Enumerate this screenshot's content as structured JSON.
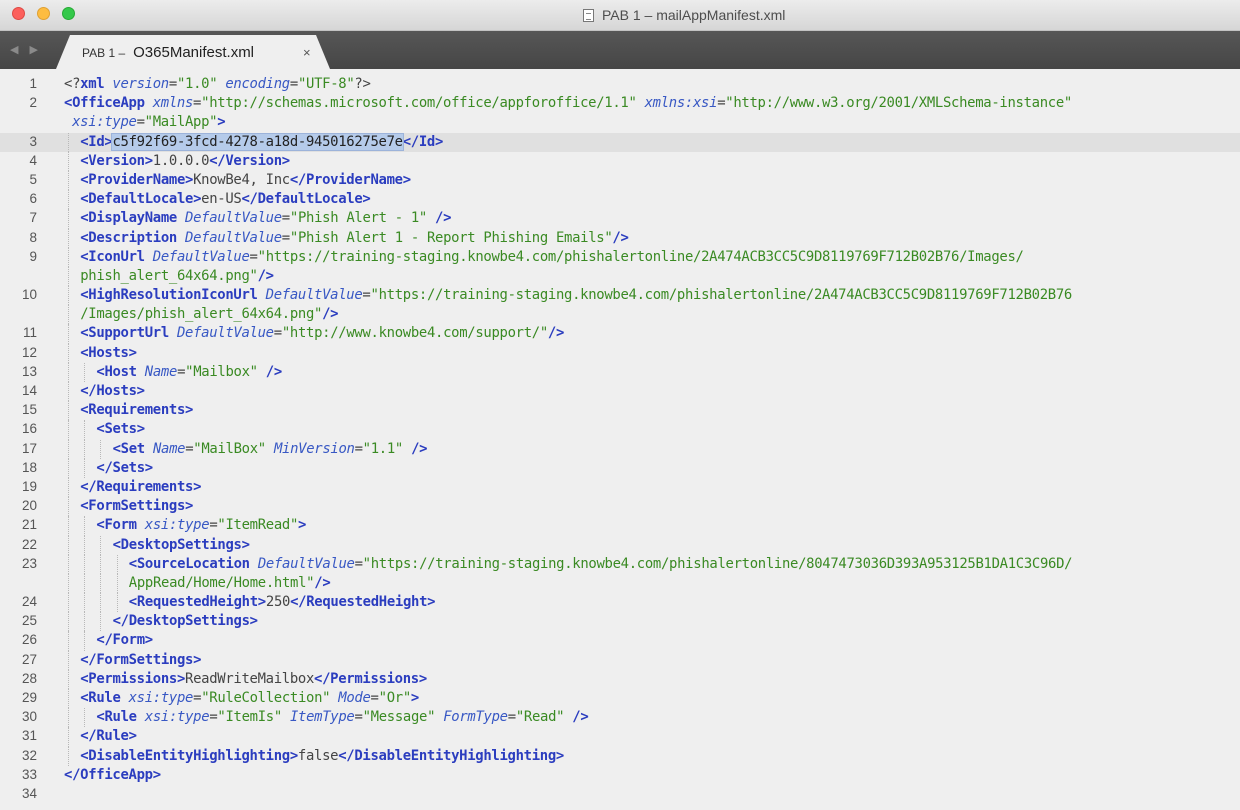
{
  "window": {
    "title": "PAB 1 – mailAppManifest.xml"
  },
  "tab": {
    "prefix": "PAB 1 –",
    "filename": "O365Manifest.xml",
    "close_glyph": "×"
  },
  "nav_arrows": "◀ ▶",
  "editor": {
    "current_line": 3,
    "lines": [
      {
        "n": "1",
        "i": 0,
        "tok": [
          [
            "p",
            "<?"
          ],
          [
            "t",
            "xml"
          ],
          [
            "p",
            " "
          ],
          [
            "a",
            "version"
          ],
          [
            "p",
            "="
          ],
          [
            "s",
            "\"1.0\""
          ],
          [
            "p",
            " "
          ],
          [
            "a",
            "encoding"
          ],
          [
            "p",
            "="
          ],
          [
            "s",
            "\"UTF-8\""
          ],
          [
            "p",
            "?>"
          ]
        ]
      },
      {
        "n": "2",
        "i": 0,
        "tok": [
          [
            "t",
            "<OfficeApp"
          ],
          [
            "p",
            " "
          ],
          [
            "a",
            "xmlns"
          ],
          [
            "p",
            "="
          ],
          [
            "s",
            "\"http://schemas.microsoft.com/office/appforoffice/1.1\""
          ],
          [
            "p",
            " "
          ],
          [
            "a",
            "xmlns:xsi"
          ],
          [
            "p",
            "="
          ],
          [
            "s",
            "\"http://www.w3.org/2001/XMLSchema-instance\""
          ]
        ]
      },
      {
        "n": "",
        "i": 0,
        "tok": [
          [
            "p",
            " "
          ],
          [
            "a",
            "xsi:type"
          ],
          [
            "p",
            "="
          ],
          [
            "s",
            "\"MailApp\""
          ],
          [
            "t",
            ">"
          ]
        ]
      },
      {
        "n": "3",
        "i": 1,
        "tok": [
          [
            "t",
            "<Id>"
          ],
          [
            "sel",
            "c5f92f69-3fcd-4278-a18d-945016275e7e"
          ],
          [
            "t",
            "</Id>"
          ]
        ]
      },
      {
        "n": "4",
        "i": 1,
        "tok": [
          [
            "t",
            "<Version>"
          ],
          [
            "p",
            "1.0.0.0"
          ],
          [
            "t",
            "</Version>"
          ]
        ]
      },
      {
        "n": "5",
        "i": 1,
        "tok": [
          [
            "t",
            "<ProviderName>"
          ],
          [
            "p",
            "KnowBe4, Inc"
          ],
          [
            "t",
            "</ProviderName>"
          ]
        ]
      },
      {
        "n": "6",
        "i": 1,
        "tok": [
          [
            "t",
            "<DefaultLocale>"
          ],
          [
            "p",
            "en-US"
          ],
          [
            "t",
            "</DefaultLocale>"
          ]
        ]
      },
      {
        "n": "7",
        "i": 1,
        "tok": [
          [
            "t",
            "<DisplayName"
          ],
          [
            "p",
            " "
          ],
          [
            "a",
            "DefaultValue"
          ],
          [
            "p",
            "="
          ],
          [
            "s",
            "\"Phish Alert - 1\""
          ],
          [
            "p",
            " "
          ],
          [
            "t",
            "/>"
          ]
        ]
      },
      {
        "n": "8",
        "i": 1,
        "tok": [
          [
            "t",
            "<Description"
          ],
          [
            "p",
            " "
          ],
          [
            "a",
            "DefaultValue"
          ],
          [
            "p",
            "="
          ],
          [
            "s",
            "\"Phish Alert 1 - Report Phishing Emails\""
          ],
          [
            "t",
            "/>"
          ]
        ]
      },
      {
        "n": "9",
        "i": 1,
        "tok": [
          [
            "t",
            "<IconUrl"
          ],
          [
            "p",
            " "
          ],
          [
            "a",
            "DefaultValue"
          ],
          [
            "p",
            "="
          ],
          [
            "s",
            "\"https://training-staging.knowbe4.com/phishalertonline/2A474ACB3CC5C9D8119769F712B02B76/Images/"
          ]
        ]
      },
      {
        "n": "",
        "i": 1,
        "tok": [
          [
            "s",
            "phish_alert_64x64.png\""
          ],
          [
            "t",
            "/>"
          ]
        ]
      },
      {
        "n": "10",
        "i": 1,
        "tok": [
          [
            "t",
            "<HighResolutionIconUrl"
          ],
          [
            "p",
            " "
          ],
          [
            "a",
            "DefaultValue"
          ],
          [
            "p",
            "="
          ],
          [
            "s",
            "\"https://training-staging.knowbe4.com/phishalertonline/2A474ACB3CC5C9D8119769F712B02B76"
          ]
        ]
      },
      {
        "n": "",
        "i": 1,
        "tok": [
          [
            "s",
            "/Images/phish_alert_64x64.png\""
          ],
          [
            "t",
            "/>"
          ]
        ]
      },
      {
        "n": "11",
        "i": 1,
        "tok": [
          [
            "t",
            "<SupportUrl"
          ],
          [
            "p",
            " "
          ],
          [
            "a",
            "DefaultValue"
          ],
          [
            "p",
            "="
          ],
          [
            "s",
            "\"http://www.knowbe4.com/support/\""
          ],
          [
            "t",
            "/>"
          ]
        ]
      },
      {
        "n": "12",
        "i": 1,
        "tok": [
          [
            "t",
            "<Hosts>"
          ]
        ]
      },
      {
        "n": "13",
        "i": 2,
        "tok": [
          [
            "t",
            "<Host"
          ],
          [
            "p",
            " "
          ],
          [
            "a",
            "Name"
          ],
          [
            "p",
            "="
          ],
          [
            "s",
            "\"Mailbox\""
          ],
          [
            "p",
            " "
          ],
          [
            "t",
            "/>"
          ]
        ]
      },
      {
        "n": "14",
        "i": 1,
        "tok": [
          [
            "t",
            "</Hosts>"
          ]
        ]
      },
      {
        "n": "15",
        "i": 1,
        "tok": [
          [
            "t",
            "<Requirements>"
          ]
        ]
      },
      {
        "n": "16",
        "i": 2,
        "tok": [
          [
            "t",
            "<Sets>"
          ]
        ]
      },
      {
        "n": "17",
        "i": 3,
        "tok": [
          [
            "t",
            "<Set"
          ],
          [
            "p",
            " "
          ],
          [
            "a",
            "Name"
          ],
          [
            "p",
            "="
          ],
          [
            "s",
            "\"MailBox\""
          ],
          [
            "p",
            " "
          ],
          [
            "a",
            "MinVersion"
          ],
          [
            "p",
            "="
          ],
          [
            "s",
            "\"1.1\""
          ],
          [
            "p",
            " "
          ],
          [
            "t",
            "/>"
          ]
        ]
      },
      {
        "n": "18",
        "i": 2,
        "tok": [
          [
            "t",
            "</Sets>"
          ]
        ]
      },
      {
        "n": "19",
        "i": 1,
        "tok": [
          [
            "t",
            "</Requirements>"
          ]
        ]
      },
      {
        "n": "20",
        "i": 1,
        "tok": [
          [
            "t",
            "<FormSettings>"
          ]
        ]
      },
      {
        "n": "21",
        "i": 2,
        "tok": [
          [
            "t",
            "<Form"
          ],
          [
            "p",
            " "
          ],
          [
            "a",
            "xsi:type"
          ],
          [
            "p",
            "="
          ],
          [
            "s",
            "\"ItemRead\""
          ],
          [
            "t",
            ">"
          ]
        ]
      },
      {
        "n": "22",
        "i": 3,
        "tok": [
          [
            "t",
            "<DesktopSettings>"
          ]
        ]
      },
      {
        "n": "23",
        "i": 4,
        "tok": [
          [
            "t",
            "<SourceLocation"
          ],
          [
            "p",
            " "
          ],
          [
            "a",
            "DefaultValue"
          ],
          [
            "p",
            "="
          ],
          [
            "s",
            "\"https://training-staging.knowbe4.com/phishalertonline/8047473036D393A953125B1DA1C3C96D/"
          ]
        ]
      },
      {
        "n": "",
        "i": 4,
        "tok": [
          [
            "s",
            "AppRead/Home/Home.html\""
          ],
          [
            "t",
            "/>"
          ]
        ]
      },
      {
        "n": "24",
        "i": 4,
        "tok": [
          [
            "t",
            "<RequestedHeight>"
          ],
          [
            "p",
            "250"
          ],
          [
            "t",
            "</RequestedHeight>"
          ]
        ]
      },
      {
        "n": "25",
        "i": 3,
        "tok": [
          [
            "t",
            "</DesktopSettings>"
          ]
        ]
      },
      {
        "n": "26",
        "i": 2,
        "tok": [
          [
            "t",
            "</Form>"
          ]
        ]
      },
      {
        "n": "27",
        "i": 1,
        "tok": [
          [
            "t",
            "</FormSettings>"
          ]
        ]
      },
      {
        "n": "28",
        "i": 1,
        "tok": [
          [
            "t",
            "<Permissions>"
          ],
          [
            "p",
            "ReadWriteMailbox"
          ],
          [
            "t",
            "</Permissions>"
          ]
        ]
      },
      {
        "n": "29",
        "i": 1,
        "tok": [
          [
            "t",
            "<Rule"
          ],
          [
            "p",
            " "
          ],
          [
            "a",
            "xsi:type"
          ],
          [
            "p",
            "="
          ],
          [
            "s",
            "\"RuleCollection\""
          ],
          [
            "p",
            " "
          ],
          [
            "a",
            "Mode"
          ],
          [
            "p",
            "="
          ],
          [
            "s",
            "\"Or\""
          ],
          [
            "t",
            ">"
          ]
        ]
      },
      {
        "n": "30",
        "i": 2,
        "tok": [
          [
            "t",
            "<Rule"
          ],
          [
            "p",
            " "
          ],
          [
            "a",
            "xsi:type"
          ],
          [
            "p",
            "="
          ],
          [
            "s",
            "\"ItemIs\""
          ],
          [
            "p",
            " "
          ],
          [
            "a",
            "ItemType"
          ],
          [
            "p",
            "="
          ],
          [
            "s",
            "\"Message\""
          ],
          [
            "p",
            " "
          ],
          [
            "a",
            "FormType"
          ],
          [
            "p",
            "="
          ],
          [
            "s",
            "\"Read\""
          ],
          [
            "p",
            " "
          ],
          [
            "t",
            "/>"
          ]
        ]
      },
      {
        "n": "31",
        "i": 1,
        "tok": [
          [
            "t",
            "</Rule>"
          ]
        ]
      },
      {
        "n": "32",
        "i": 1,
        "tok": [
          [
            "t",
            "<DisableEntityHighlighting>"
          ],
          [
            "p",
            "false"
          ],
          [
            "t",
            "</DisableEntityHighlighting>"
          ]
        ]
      },
      {
        "n": "33",
        "i": 0,
        "tok": [
          [
            "t",
            "</OfficeApp>"
          ]
        ]
      },
      {
        "n": "34",
        "i": 0,
        "tok": []
      }
    ]
  }
}
